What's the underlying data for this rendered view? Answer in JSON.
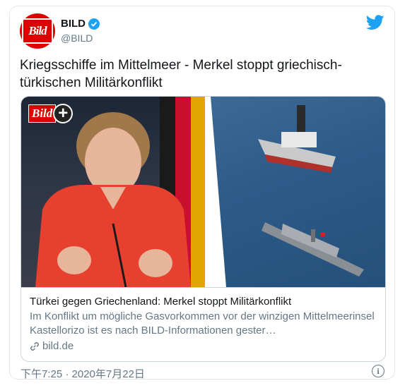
{
  "account": {
    "name": "BILD",
    "handle": "@BILD",
    "avatar_text": "Bild",
    "verified": true
  },
  "tweet": {
    "text": "Kriegsschiffe im Mittelmeer - Merkel stoppt griechisch-türkischen Militärkonflikt",
    "timestamp": "下午7:25 · 2020年7月22日"
  },
  "media": {
    "badge_text": "Bild",
    "badge_plus": "+"
  },
  "link_card": {
    "title": "Türkei gegen Griechenland: Merkel stoppt Militärkonflikt",
    "description": "Im Konflikt um mögliche Gasvorkommen vor der winzigen Mittelmeerinsel Kastellorizo ist es nach BILD-Informationen gester…",
    "domain": "bild.de"
  },
  "icons": {
    "brand": "twitter-bird-icon",
    "verified": "verified-badge-icon",
    "link": "link-icon",
    "info": "info-icon"
  },
  "colors": {
    "twitter_blue": "#1da1f2",
    "bild_red": "#dd0000",
    "secondary_text": "#657786"
  }
}
